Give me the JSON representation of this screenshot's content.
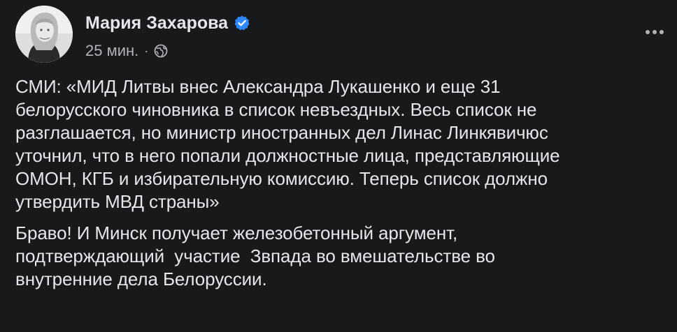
{
  "post": {
    "author": {
      "name": "Мария Захарова",
      "verified": true,
      "avatar_icon": "profile-photo"
    },
    "meta": {
      "time": "25 мин.",
      "separator": "·",
      "audience_icon": "globe-icon"
    },
    "menu_icon": "more-horizontal-icon",
    "paragraphs": [
      "СМИ: «МИД Литвы внес Александра Лукашенко и еще 31\nбелорусского чиновника в список невъездных. Весь список не\nразглашается, но министр иностранных дел Линас Линкявичюс\nуточнил, что в него попали должностные лица, представляющие\nОМОН, КГБ и избирательную комиссию. Теперь список должно\nутвердить МВД страны»",
      "Браво! И Минск получает железобетонный аргумент,\nподтверждающий  участие  Звпада во вмешательстве во\nвнутренние дела Белоруссии."
    ]
  },
  "colors": {
    "background": "#18191a",
    "primary_text": "#e4e6eb",
    "secondary_text": "#b0b3b8",
    "verified_badge": "#2d88ff"
  }
}
